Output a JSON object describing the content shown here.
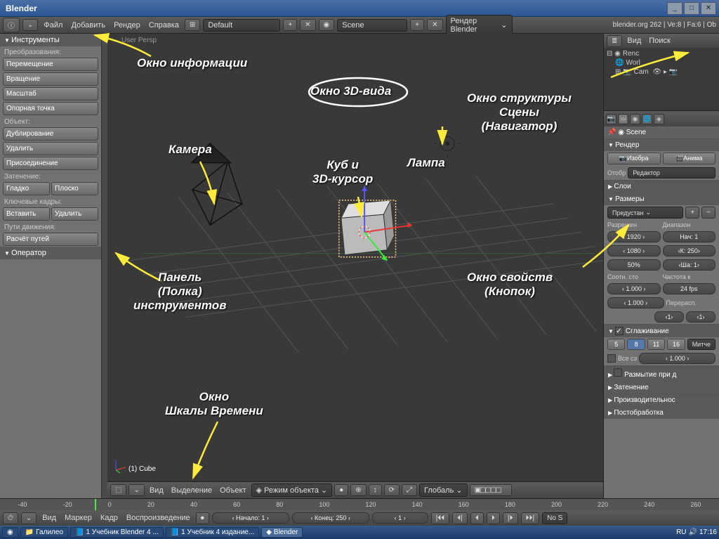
{
  "window": {
    "title": "Blender"
  },
  "info": {
    "menus": [
      "Файл",
      "Добавить",
      "Рендер",
      "Справка"
    ],
    "layout": "Default",
    "scene": "Scene",
    "engine": "Рендер Blender",
    "stats": "blender.org 262 | Ve:8 | Fa:6 | Ob"
  },
  "toolshelf": {
    "title": "Инструменты",
    "transform_label": "Преобразования:",
    "translate": "Перемещение",
    "rotate": "Вращение",
    "scale": "Масштаб",
    "origin": "Опорная точка",
    "object_label": "Объект:",
    "duplicate": "Дублирование",
    "delete": "Удалить",
    "join": "Присоединение",
    "shading_label": "Затенение:",
    "smooth": "Гладко",
    "flat": "Плоско",
    "keyframes_label": "Ключевые кадры:",
    "insert": "Вставить",
    "remove": "Удалить",
    "motion_label": "Пути движения:",
    "calc": "Расчёт путей",
    "operator": "Оператор"
  },
  "view3d": {
    "persp": "User Persp",
    "obj": "(1) Cube",
    "h_view": "Вид",
    "h_select": "Выделение",
    "h_object": "Объект",
    "h_mode": "Режим объекта",
    "h_orient": "Глобаль"
  },
  "outliner": {
    "view": "Вид",
    "search": "Поиск",
    "items": [
      "Renc",
      "Worl",
      "Cam"
    ]
  },
  "props": {
    "breadcrumb": "Scene",
    "render": "Рендер",
    "img_btn": "Изобра",
    "anim_btn": "Анима",
    "display_label": "Отобр",
    "display_val": "Редактор",
    "layers": "Слои",
    "dims": "Размеры",
    "preset": "Предустан",
    "res_label": "Разрешен",
    "range_label": "Диапазон",
    "resx": "1920",
    "resy": "1080",
    "res_pct": "50%",
    "start": "Нач: 1",
    "end": "К: 250",
    "step": "Ша: 1",
    "aspect_label": "Соотн. сто",
    "fps_label": "Частота к",
    "asp1": "1.000",
    "fps": "24 fps",
    "asp2": "1.000",
    "remap": "Перерасп.",
    "r1": "1",
    "r2": "1",
    "aa": "Сглаживание",
    "aa_samples": [
      "5",
      "8",
      "11",
      "16"
    ],
    "aa_filter": "Митче",
    "aa_full": "Все сэ",
    "aa_size": "1.000",
    "mblur": "Размытие при д",
    "shading": "Затенение",
    "perf": "Производительнос",
    "post": "Постобработка"
  },
  "timeline": {
    "ticks": [
      "-40",
      "-20",
      "0",
      "20",
      "40",
      "60",
      "80",
      "100",
      "120",
      "140",
      "160",
      "180",
      "200",
      "220",
      "240",
      "260"
    ],
    "view": "Вид",
    "marker": "Маркер",
    "frame": "Кадр",
    "playback": "Воспроизведение",
    "start": "Начало: 1",
    "end": "Конец: 250",
    "current": "1",
    "sync": "No S"
  },
  "taskbar": {
    "folder": "Галилео",
    "doc1": "1 Учебник Blender 4 ...",
    "doc2": "1 Учебник 4 издание...",
    "app": "Blender",
    "lang": "RU",
    "time": "17:16"
  },
  "annotations": {
    "info": "Окно информации",
    "view3d": "Окно 3D-вида",
    "outliner_l1": "Окно структуры",
    "outliner_l2": "Сцены",
    "outliner_l3": "(Навигатор)",
    "camera": "Камера",
    "cube_l1": "Куб и",
    "cube_l2": "3D-курсор",
    "lamp": "Лампа",
    "tools_l1": "Панель",
    "tools_l2": "(Полка)",
    "tools_l3": "инструментов",
    "props_l1": "Окно свойств",
    "props_l2": "(Кнопок)",
    "tl_l1": "Окно",
    "tl_l2": "Шкалы Времени"
  }
}
